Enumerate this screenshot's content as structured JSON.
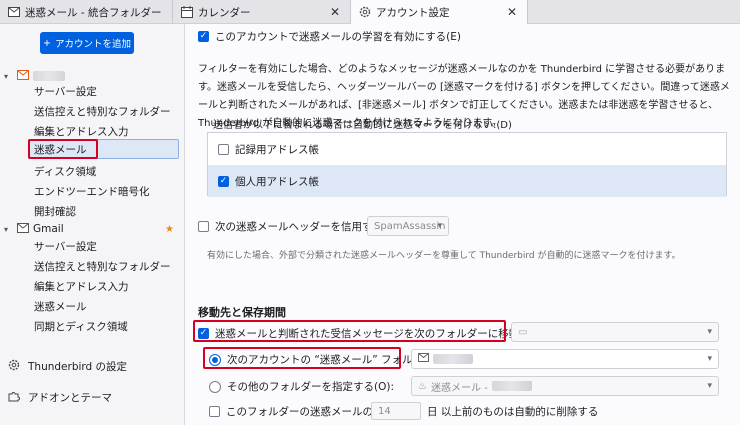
{
  "tabs": [
    {
      "label": "迷惑メール - 統合フォルダー",
      "icon": "envelope-icon"
    },
    {
      "label": "カレンダー",
      "icon": "calendar-icon"
    },
    {
      "label": "アカウント設定",
      "icon": "gear-icon"
    }
  ],
  "sidebar": {
    "add_account": "アカウントを追加",
    "account1": {
      "items": [
        "サーバー設定",
        "送信控えと特別なフォルダー",
        "編集とアドレス入力",
        "迷惑メール",
        "ディスク領域",
        "エンドツーエンド暗号化",
        "開封確認"
      ]
    },
    "account2": {
      "name": "Gmail",
      "items": [
        "サーバー設定",
        "送信控えと特別なフォルダー",
        "編集とアドレス入力",
        "迷惑メール",
        "同期とディスク領域"
      ]
    },
    "settings": "Thunderbird の設定",
    "addons": "アドオンとテーマ"
  },
  "main": {
    "enable_learning": "このアカウントで迷惑メールの学習を有効にする(E)",
    "description": "フィルターを有効にした場合、どのようなメッセージが迷惑メールなのかを Thunderbird に学習させる必要があります。迷惑メールを受信したら、ヘッダーツールバーの [迷惑マークを付ける] ボタンを押してください。間違って迷惑メールと判断されたメールがあれば、[非迷惑メール] ボタンで訂正してください。迷惑または非迷惑を学習させると、Thunderbird が自動的に迷惑マークを付けられるようになります。",
    "whitelist_label": "送信者が以下に含まれる場合は自動的に迷惑マークを付けない:(D)",
    "whitelist": [
      {
        "label": "記録用アドレス帳",
        "checked": false
      },
      {
        "label": "個人用アドレス帳",
        "checked": true
      }
    ],
    "trust_header_label": "次の迷惑メールヘッダーを信用する(T):",
    "trust_header_value": "SpamAssassin",
    "trust_header_desc": "有効にした場合、外部で分類された迷惑メールヘッダーを尊重して Thunderbird が自動的に迷惑マークを付けます。",
    "section_title": "移動先と保存期間",
    "move_label": "迷惑メールと判断された受信メッセージを次のフォルダーに移動する(M):",
    "radio_account": "次のアカウントの “迷惑メール” フォルダー(S):",
    "radio_other": "その他のフォルダーを指定する(O):",
    "other_folder_value": "迷惑メール -",
    "delete_label": "このフォルダーの迷惑メールのうち(U)",
    "delete_days": "14",
    "delete_suffix": "日 以上前のものは自動的に削除する"
  },
  "colors": {
    "accent": "#0061e0",
    "highlight": "#d70022",
    "selected_bg": "#dee7f5"
  }
}
